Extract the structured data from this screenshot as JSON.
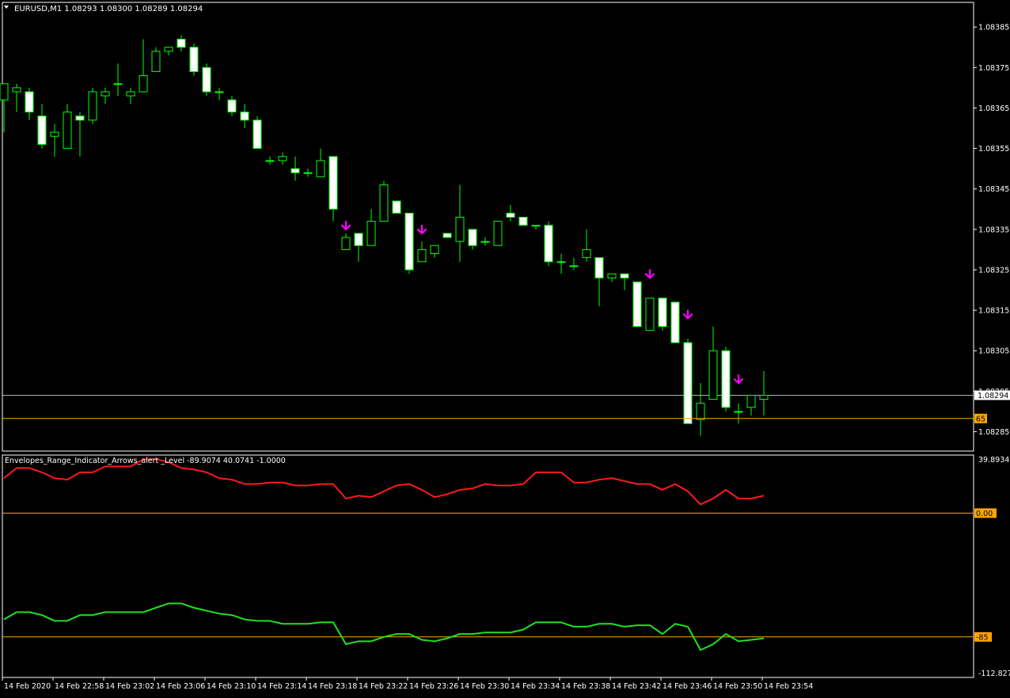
{
  "header": {
    "symbol_info": "EURUSD,M1  1.08293 1.08300 1.08289 1.08294"
  },
  "indicator": {
    "title": "Envelopes_Range_Indicator_Arrows_alert _Level -89.9074 40.0741 -1.0000"
  },
  "colors": {
    "background": "#000000",
    "axis": "#ffffff",
    "bull_candle": "#000000",
    "bear_candle": "#ffffff",
    "candle_outline": "#00ff00",
    "arrow": "#ff00ff",
    "bid_line": "#aab2bd",
    "level_line": "#ffa500",
    "red_line": "#ff1a1a",
    "green_line": "#22e022"
  },
  "price_axis": {
    "ticks": [
      "1.08385",
      "1.08375",
      "1.08365",
      "1.08355",
      "1.08345",
      "1.08335",
      "1.08325",
      "1.08315",
      "1.08305",
      "1.08295",
      "1.08285"
    ],
    "current_price_label": "1.08294"
  },
  "indicator_axis": {
    "top_value": "39.8934",
    "top_level": "65",
    "zero_level": "0.00",
    "bottom_level": "-85",
    "bottom_value": "-112.8274"
  },
  "time_axis": {
    "labels": [
      "14 Feb 2020",
      "14 Feb 22:58",
      "14 Feb 23:02",
      "14 Feb 23:06",
      "14 Feb 23:10",
      "14 Feb 23:14",
      "14 Feb 23:18",
      "14 Feb 23:22",
      "14 Feb 23:26",
      "14 Feb 23:30",
      "14 Feb 23:34",
      "14 Feb 23:38",
      "14 Feb 23:42",
      "14 Feb 23:46",
      "14 Feb 23:50",
      "14 Feb 23:54"
    ]
  },
  "chart_data": [
    {
      "type": "candlestick",
      "title": "EURUSD,M1",
      "ylim": [
        1.082802,
        1.083911
      ],
      "current_price": 1.08294,
      "candles": [
        {
          "o": 1.08367,
          "h": 1.08371,
          "l": 1.08359,
          "c": 1.08371
        },
        {
          "o": 1.08369,
          "h": 1.08371,
          "l": 1.08364,
          "c": 1.0837
        },
        {
          "o": 1.08369,
          "h": 1.0837,
          "l": 1.08362,
          "c": 1.08364
        },
        {
          "o": 1.08363,
          "h": 1.08366,
          "l": 1.08355,
          "c": 1.08356
        },
        {
          "o": 1.08358,
          "h": 1.08361,
          "l": 1.08353,
          "c": 1.08359
        },
        {
          "o": 1.08355,
          "h": 1.08366,
          "l": 1.08355,
          "c": 1.08364
        },
        {
          "o": 1.08363,
          "h": 1.08364,
          "l": 1.08353,
          "c": 1.08362
        },
        {
          "o": 1.08362,
          "h": 1.0837,
          "l": 1.08361,
          "c": 1.08369
        },
        {
          "o": 1.08368,
          "h": 1.0837,
          "l": 1.08366,
          "c": 1.08369
        },
        {
          "o": 1.08371,
          "h": 1.08376,
          "l": 1.08368,
          "c": 1.08371
        },
        {
          "o": 1.08368,
          "h": 1.0837,
          "l": 1.08366,
          "c": 1.08369
        },
        {
          "o": 1.08369,
          "h": 1.08382,
          "l": 1.08369,
          "c": 1.08373
        },
        {
          "o": 1.08374,
          "h": 1.0838,
          "l": 1.08374,
          "c": 1.08379
        },
        {
          "o": 1.08379,
          "h": 1.0838,
          "l": 1.08378,
          "c": 1.0838
        },
        {
          "o": 1.08382,
          "h": 1.08383,
          "l": 1.08379,
          "c": 1.0838
        },
        {
          "o": 1.0838,
          "h": 1.08381,
          "l": 1.08373,
          "c": 1.08374
        },
        {
          "o": 1.08375,
          "h": 1.08376,
          "l": 1.08368,
          "c": 1.08369
        },
        {
          "o": 1.08369,
          "h": 1.0837,
          "l": 1.08367,
          "c": 1.08369
        },
        {
          "o": 1.08367,
          "h": 1.08368,
          "l": 1.08363,
          "c": 1.08364
        },
        {
          "o": 1.08364,
          "h": 1.08366,
          "l": 1.0836,
          "c": 1.08362
        },
        {
          "o": 1.08362,
          "h": 1.08363,
          "l": 1.08355,
          "c": 1.08355
        },
        {
          "o": 1.08352,
          "h": 1.08353,
          "l": 1.08351,
          "c": 1.08352
        },
        {
          "o": 1.08352,
          "h": 1.08354,
          "l": 1.08351,
          "c": 1.08353
        },
        {
          "o": 1.0835,
          "h": 1.08353,
          "l": 1.08347,
          "c": 1.08349
        },
        {
          "o": 1.08349,
          "h": 1.0835,
          "l": 1.08348,
          "c": 1.08349
        },
        {
          "o": 1.08348,
          "h": 1.08355,
          "l": 1.08348,
          "c": 1.08352
        },
        {
          "o": 1.08353,
          "h": 1.08353,
          "l": 1.08337,
          "c": 1.0834
        },
        {
          "o": 1.0833,
          "h": 1.08334,
          "l": 1.0833,
          "c": 1.08333
        },
        {
          "o": 1.08334,
          "h": 1.08334,
          "l": 1.08327,
          "c": 1.08331
        },
        {
          "o": 1.08331,
          "h": 1.0834,
          "l": 1.08331,
          "c": 1.08337
        },
        {
          "o": 1.08337,
          "h": 1.08347,
          "l": 1.08337,
          "c": 1.08346
        },
        {
          "o": 1.08342,
          "h": 1.08342,
          "l": 1.08339,
          "c": 1.08339
        },
        {
          "o": 1.08339,
          "h": 1.08339,
          "l": 1.08324,
          "c": 1.08325
        },
        {
          "o": 1.08327,
          "h": 1.08332,
          "l": 1.08327,
          "c": 1.0833
        },
        {
          "o": 1.08329,
          "h": 1.08331,
          "l": 1.08328,
          "c": 1.08331
        },
        {
          "o": 1.08334,
          "h": 1.08334,
          "l": 1.08333,
          "c": 1.08333
        },
        {
          "o": 1.08332,
          "h": 1.08346,
          "l": 1.08327,
          "c": 1.08338
        },
        {
          "o": 1.08335,
          "h": 1.08335,
          "l": 1.0833,
          "c": 1.08331
        },
        {
          "o": 1.08332,
          "h": 1.08333,
          "l": 1.08331,
          "c": 1.08332
        },
        {
          "o": 1.08331,
          "h": 1.08337,
          "l": 1.08331,
          "c": 1.08337
        },
        {
          "o": 1.08339,
          "h": 1.08341,
          "l": 1.08337,
          "c": 1.08338
        },
        {
          "o": 1.08338,
          "h": 1.08338,
          "l": 1.08336,
          "c": 1.08336
        },
        {
          "o": 1.08336,
          "h": 1.08336,
          "l": 1.08335,
          "c": 1.08336
        },
        {
          "o": 1.08336,
          "h": 1.08337,
          "l": 1.08326,
          "c": 1.08327
        },
        {
          "o": 1.08327,
          "h": 1.08329,
          "l": 1.08324,
          "c": 1.08327
        },
        {
          "o": 1.08326,
          "h": 1.08328,
          "l": 1.08325,
          "c": 1.08326
        },
        {
          "o": 1.08328,
          "h": 1.08335,
          "l": 1.08327,
          "c": 1.0833
        },
        {
          "o": 1.08328,
          "h": 1.08328,
          "l": 1.08316,
          "c": 1.08323
        },
        {
          "o": 1.08323,
          "h": 1.08324,
          "l": 1.08322,
          "c": 1.08324
        },
        {
          "o": 1.08324,
          "h": 1.08324,
          "l": 1.0832,
          "c": 1.08323
        },
        {
          "o": 1.08322,
          "h": 1.08322,
          "l": 1.08311,
          "c": 1.08311
        },
        {
          "o": 1.0831,
          "h": 1.08318,
          "l": 1.0831,
          "c": 1.08318
        },
        {
          "o": 1.08318,
          "h": 1.08318,
          "l": 1.0831,
          "c": 1.08311
        },
        {
          "o": 1.08317,
          "h": 1.08317,
          "l": 1.08307,
          "c": 1.08307
        },
        {
          "o": 1.08307,
          "h": 1.08308,
          "l": 1.08287,
          "c": 1.08287
        },
        {
          "o": 1.08288,
          "h": 1.08297,
          "l": 1.08284,
          "c": 1.08292
        },
        {
          "o": 1.08293,
          "h": 1.08311,
          "l": 1.08293,
          "c": 1.08305
        },
        {
          "o": 1.08305,
          "h": 1.08306,
          "l": 1.0829,
          "c": 1.08291
        },
        {
          "o": 1.0829,
          "h": 1.08292,
          "l": 1.08287,
          "c": 1.0829
        },
        {
          "o": 1.08291,
          "h": 1.08294,
          "l": 1.08289,
          "c": 1.08294
        },
        {
          "o": 1.08293,
          "h": 1.083,
          "l": 1.08289,
          "c": 1.08294
        }
      ],
      "sell_arrows": [
        {
          "bar": 27,
          "price": 1.08335
        },
        {
          "bar": 33,
          "price": 1.08334
        },
        {
          "bar": 51,
          "price": 1.08323
        },
        {
          "bar": 54,
          "price": 1.08313
        },
        {
          "bar": 58,
          "price": 1.08297
        }
      ]
    },
    {
      "type": "line",
      "title": "Envelopes_Range_Indicator_Arrows_alert _Level -89.9074 40.0741 -1.0000",
      "ylim": [
        -112.8274,
        39.8934
      ],
      "levels": [
        65,
        0,
        -85
      ],
      "series": [
        {
          "color": "#ff1a1a",
          "values": [
            24,
            31,
            31,
            28,
            24,
            23,
            28,
            28,
            32,
            32,
            32,
            37,
            37,
            35,
            31,
            30,
            28,
            24,
            23,
            20,
            20,
            21,
            21,
            19,
            19,
            20,
            20,
            10,
            12,
            11,
            15,
            19,
            20,
            16,
            11,
            13,
            16,
            17,
            20,
            19,
            19,
            20,
            28,
            28,
            28,
            21,
            21,
            23,
            24,
            22,
            20,
            20,
            16,
            20,
            15,
            6,
            10,
            16,
            10,
            10,
            12
          ],
          "color_hex": "#ff1a1a"
        },
        {
          "color": "#22e022",
          "values": [
            -73,
            -68,
            -68,
            -70,
            -74,
            -74,
            -70,
            -70,
            -68,
            -68,
            -68,
            -68,
            -65,
            -62,
            -62,
            -65,
            -67,
            -69,
            -70,
            -73,
            -74,
            -74,
            -76,
            -76,
            -76,
            -75,
            -75,
            -90,
            -88,
            -88,
            -85,
            -83,
            -83,
            -87,
            -88,
            -86,
            -83,
            -83,
            -82,
            -82,
            -82,
            -80,
            -75,
            -75,
            -75,
            -78,
            -78,
            -76,
            -76,
            -78,
            -77,
            -77,
            -83,
            -76,
            -78,
            -94,
            -90,
            -83,
            -88,
            -87,
            -86
          ]
        }
      ]
    }
  ]
}
